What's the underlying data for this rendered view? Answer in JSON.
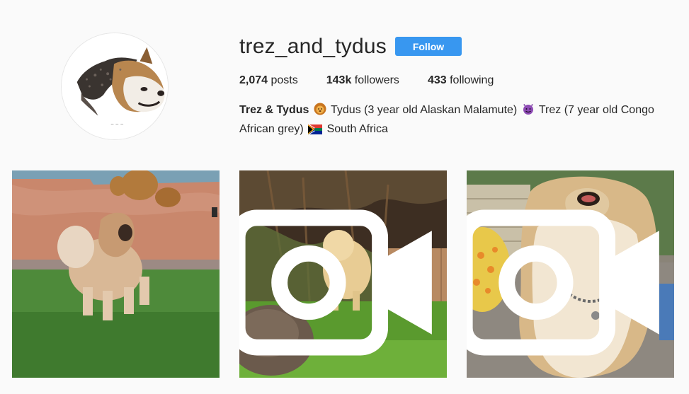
{
  "profile": {
    "username": "trez_and_tydus",
    "follow_label": "Follow",
    "avatar_icon": "malamute-avatar",
    "stats": {
      "posts_count": "2,074",
      "posts_label": "posts",
      "followers_count": "143k",
      "followers_label": "followers",
      "following_count": "433",
      "following_label": "following"
    },
    "bio": {
      "name": "Trez & Tydus",
      "part1": "Tydus (3 year old Alaskan Malamute)",
      "part2": "Trez (7 year old Congo African grey)",
      "part3": "South Africa",
      "emojis": [
        "lion-face",
        "smiling-imp",
        "south-africa-flag"
      ]
    }
  },
  "posts": [
    {
      "type": "photo",
      "icon": "none"
    },
    {
      "type": "video",
      "icon": "video-camera-icon"
    },
    {
      "type": "video",
      "icon": "video-camera-icon"
    }
  ],
  "colors": {
    "accent": "#3897f0",
    "background": "#fafafa",
    "text": "#262626"
  }
}
